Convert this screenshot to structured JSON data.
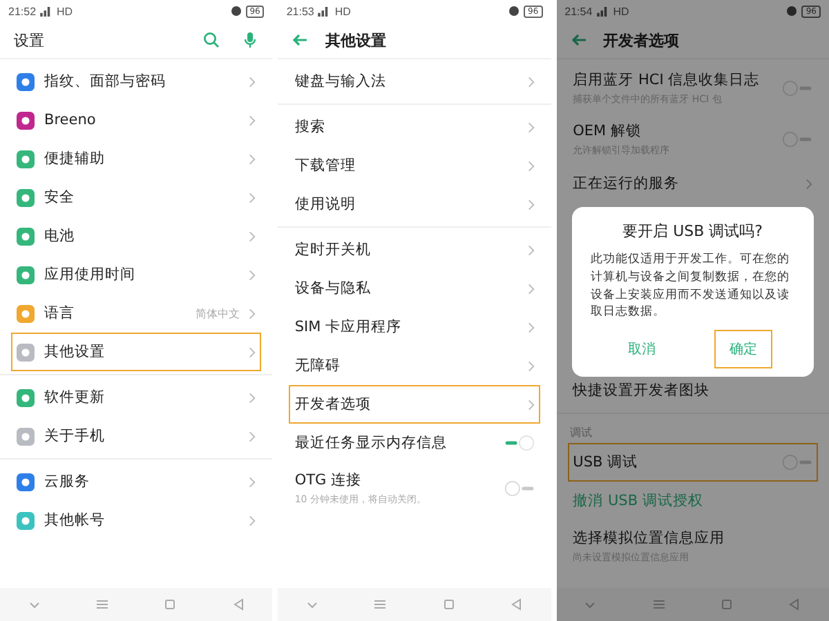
{
  "screens": [
    {
      "status": {
        "time": "21:52",
        "network": "HD",
        "battery": "96"
      },
      "header": {
        "kind": "search",
        "title": "设置"
      },
      "sections": [
        {
          "items": [
            {
              "label": "指纹、面部与密码",
              "kind": "link",
              "color": "#2f7fe8",
              "highlighted": false
            },
            {
              "label": "Breeno",
              "kind": "link",
              "color": "#c0288f",
              "highlighted": false
            },
            {
              "label": "便捷辅助",
              "kind": "link",
              "color": "#35b77c",
              "highlighted": false
            },
            {
              "label": "安全",
              "kind": "link",
              "color": "#35b77c",
              "highlighted": false
            },
            {
              "label": "电池",
              "kind": "link",
              "color": "#35b77c",
              "highlighted": false
            },
            {
              "label": "应用使用时间",
              "kind": "link",
              "color": "#35b77c",
              "highlighted": false
            },
            {
              "label": "语言",
              "value": "简体中文",
              "kind": "link",
              "color": "#f0a830",
              "highlighted": false
            },
            {
              "label": "其他设置",
              "kind": "link",
              "color": "#b8bcc2",
              "highlighted": true
            }
          ]
        },
        {
          "items": [
            {
              "label": "软件更新",
              "kind": "link",
              "color": "#35b77c",
              "highlighted": false
            },
            {
              "label": "关于手机",
              "kind": "link",
              "color": "#b8bcc2",
              "highlighted": false
            }
          ]
        },
        {
          "items": [
            {
              "label": "云服务",
              "kind": "link",
              "color": "#2f7fe8",
              "highlighted": false
            },
            {
              "label": "其他帐号",
              "kind": "link",
              "color": "#3cc3c0",
              "highlighted": false
            }
          ]
        }
      ]
    },
    {
      "status": {
        "time": "21:53",
        "network": "HD",
        "battery": "96"
      },
      "header": {
        "kind": "back",
        "title": "其他设置"
      },
      "sections": [
        {
          "items": [
            {
              "label": "键盘与输入法",
              "kind": "link",
              "highlighted": false
            }
          ]
        },
        {
          "items": [
            {
              "label": "搜索",
              "kind": "link",
              "highlighted": false
            },
            {
              "label": "下载管理",
              "kind": "link",
              "highlighted": false
            },
            {
              "label": "使用说明",
              "kind": "link",
              "highlighted": false
            }
          ]
        },
        {
          "items": [
            {
              "label": "定时开关机",
              "kind": "link",
              "highlighted": false
            },
            {
              "label": "设备与隐私",
              "kind": "link",
              "highlighted": false
            },
            {
              "label": "SIM 卡应用程序",
              "kind": "link",
              "highlighted": false
            },
            {
              "label": "无障碍",
              "kind": "link",
              "highlighted": false
            },
            {
              "label": "开发者选项",
              "kind": "link",
              "highlighted": true
            },
            {
              "label": "最近任务显示内存信息",
              "kind": "toggle",
              "on": true,
              "highlighted": false
            },
            {
              "label": "OTG 连接",
              "subtitle": "10 分钟未使用，将自动关闭。",
              "kind": "toggle",
              "on": false,
              "highlighted": false
            }
          ]
        }
      ]
    },
    {
      "status": {
        "time": "21:54",
        "network": "HD",
        "battery": "96"
      },
      "header": {
        "kind": "back",
        "title": "开发者选项"
      },
      "dimmed": true,
      "sections": [
        {
          "items": [
            {
              "label": "启用蓝牙 HCI 信息收集日志",
              "subtitle": "捕获单个文件中的所有蓝牙 HCI 包",
              "kind": "toggle",
              "on": false,
              "highlighted": false
            },
            {
              "label": "OEM 解锁",
              "subtitle": "允许解锁引导加载程序",
              "kind": "toggle",
              "on": false,
              "highlighted": false
            },
            {
              "label": "正在运行的服务",
              "kind": "link",
              "highlighted": false
            },
            {
              "kind": "hidden"
            },
            {
              "label": "快捷设置开发者图块",
              "kind": "plain",
              "highlighted": false
            }
          ]
        },
        {
          "title": "调试",
          "items": [
            {
              "label": "USB 调试",
              "kind": "toggle",
              "on": false,
              "highlighted": true
            },
            {
              "label": "撤消 USB 调试授权",
              "kind": "action",
              "highlighted": false
            },
            {
              "label": "选择模拟位置信息应用",
              "subtitle": "尚未设置模拟位置信息应用",
              "kind": "plain",
              "highlighted": false
            }
          ]
        }
      ],
      "dialog": {
        "title": "要开启 USB 调试吗?",
        "message": "此功能仅适用于开发工作。可在您的计算机与设备之间复制数据，在您的设备上安装应用而不发送通知以及读取日志数据。",
        "buttons": [
          {
            "label": "取消",
            "highlighted": false
          },
          {
            "label": "确定",
            "highlighted": true
          }
        ]
      }
    }
  ]
}
